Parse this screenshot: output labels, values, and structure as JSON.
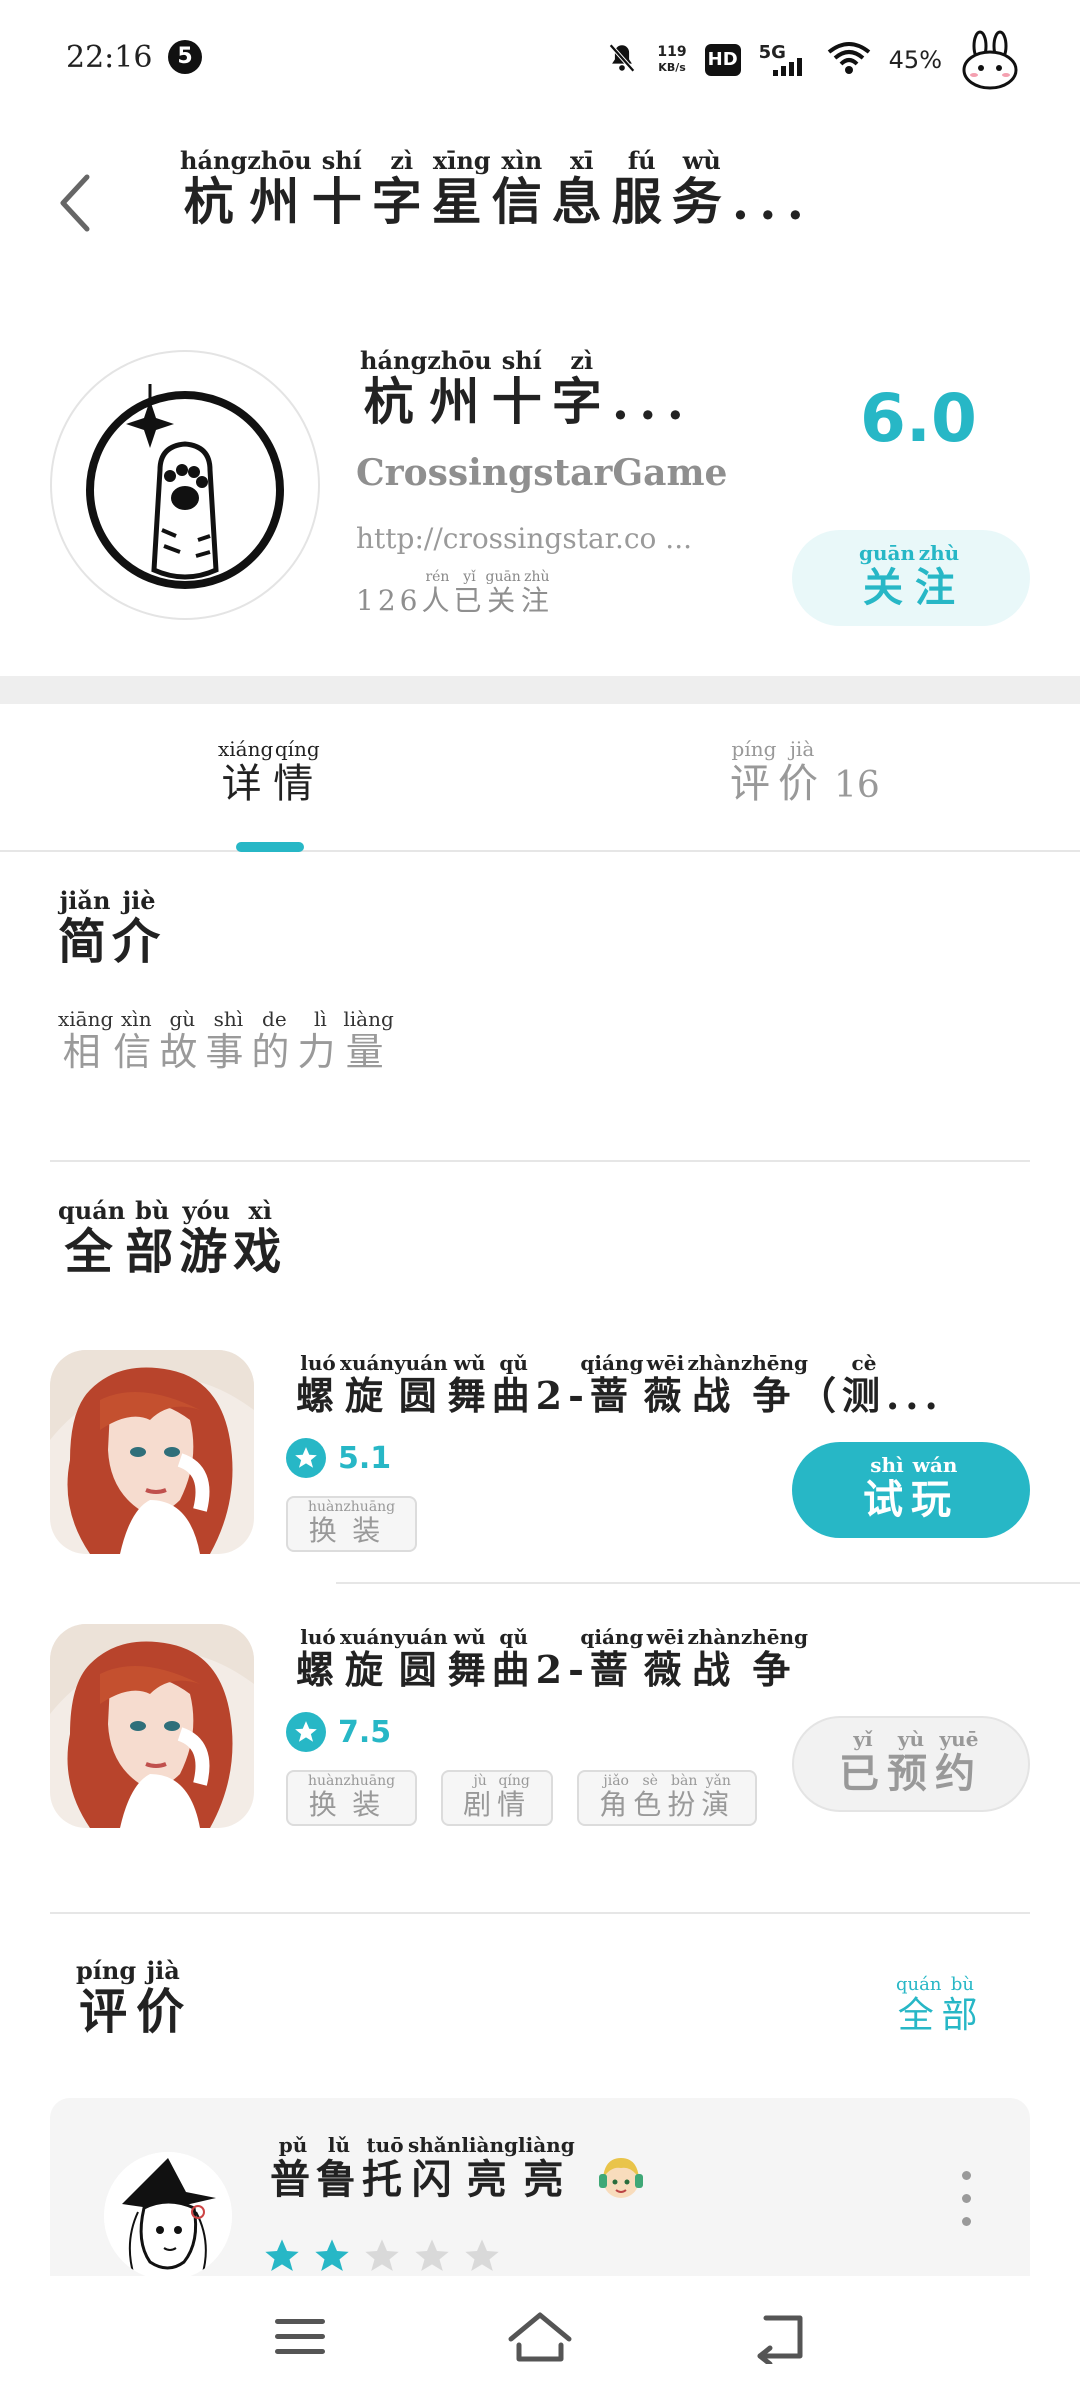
{
  "status_bar": {
    "time": "22:16",
    "notification_count": "5",
    "net_speed_value": "119",
    "net_speed_unit": "KB/s",
    "hd_label": "HD",
    "network_label": "5G",
    "battery": "45%"
  },
  "header": {
    "title": [
      {
        "c": "杭",
        "p": "háng"
      },
      {
        "c": "州",
        "p": "zhōu"
      },
      {
        "c": "十",
        "p": "shí"
      },
      {
        "c": "字",
        "p": "zì"
      },
      {
        "c": "星",
        "p": "xīng"
      },
      {
        "c": "信",
        "p": "xìn"
      },
      {
        "c": "息",
        "p": "xī"
      },
      {
        "c": "服",
        "p": "fú"
      },
      {
        "c": "务",
        "p": "wù"
      }
    ],
    "title_ellipsis": "..."
  },
  "developer": {
    "name": [
      {
        "c": "杭",
        "p": "háng"
      },
      {
        "c": "州",
        "p": "zhōu"
      },
      {
        "c": "十",
        "p": "shí"
      },
      {
        "c": "字",
        "p": "zì"
      }
    ],
    "name_ellipsis": "...",
    "english_name": "CrossingstarGame",
    "url": "http://crossingstar.co ...",
    "followers_count": "126",
    "followers_suffix": [
      {
        "c": "人",
        "p": "rén"
      },
      {
        "c": "已",
        "p": "yǐ"
      },
      {
        "c": "关",
        "p": "guān"
      },
      {
        "c": "注",
        "p": "zhù"
      }
    ],
    "score": "6.0",
    "follow_button": [
      {
        "c": "关",
        "p": "guān"
      },
      {
        "c": "注",
        "p": "zhù"
      }
    ]
  },
  "tabs": {
    "details": [
      {
        "c": "详",
        "p": "xiáng"
      },
      {
        "c": "情",
        "p": "qíng"
      }
    ],
    "reviews": [
      {
        "c": "评",
        "p": "píng"
      },
      {
        "c": "价",
        "p": "jià"
      }
    ],
    "reviews_count": "16"
  },
  "intro": {
    "title": [
      {
        "c": "简",
        "p": "jiǎn"
      },
      {
        "c": "介",
        "p": "jiè"
      }
    ],
    "text": [
      {
        "c": "相",
        "p": "xiāng"
      },
      {
        "c": "信",
        "p": "xìn"
      },
      {
        "c": "故",
        "p": "gù"
      },
      {
        "c": "事",
        "p": "shì"
      },
      {
        "c": "的",
        "p": "de"
      },
      {
        "c": "力",
        "p": "lì"
      },
      {
        "c": "量",
        "p": "liàng"
      }
    ]
  },
  "games_section": {
    "title": [
      {
        "c": "全",
        "p": "quán"
      },
      {
        "c": "部",
        "p": "bù"
      },
      {
        "c": "游",
        "p": "yóu"
      },
      {
        "c": "戏",
        "p": "xì"
      }
    ]
  },
  "games": [
    {
      "name": [
        {
          "c": "螺",
          "p": "luó"
        },
        {
          "c": "旋",
          "p": "xuán"
        },
        {
          "c": "圆",
          "p": "yuán"
        },
        {
          "c": "舞",
          "p": "wǔ"
        },
        {
          "c": "曲",
          "p": "qǔ"
        },
        {
          "c": "2-",
          "p": ""
        },
        {
          "c": "蔷",
          "p": "qiáng"
        },
        {
          "c": "薇",
          "p": "wēi"
        },
        {
          "c": "战",
          "p": "zhàn"
        },
        {
          "c": "争",
          "p": "zhēng"
        },
        {
          "c": "（",
          "p": ""
        },
        {
          "c": "测",
          "p": "cè"
        }
      ],
      "name_ellipsis": "...",
      "rating": "5.1",
      "tags": [
        [
          {
            "c": "换",
            "p": "huàn"
          },
          {
            "c": "装",
            "p": "zhuāng"
          }
        ]
      ],
      "action": [
        {
          "c": "试",
          "p": "shì"
        },
        {
          "c": "玩",
          "p": "wán"
        }
      ],
      "action_type": "play"
    },
    {
      "name": [
        {
          "c": "螺",
          "p": "luó"
        },
        {
          "c": "旋",
          "p": "xuán"
        },
        {
          "c": "圆",
          "p": "yuán"
        },
        {
          "c": "舞",
          "p": "wǔ"
        },
        {
          "c": "曲",
          "p": "qǔ"
        },
        {
          "c": "2-",
          "p": ""
        },
        {
          "c": "蔷",
          "p": "qiáng"
        },
        {
          "c": "薇",
          "p": "wēi"
        },
        {
          "c": "战",
          "p": "zhàn"
        },
        {
          "c": "争",
          "p": "zhēng"
        }
      ],
      "name_ellipsis": "",
      "rating": "7.5",
      "tags": [
        [
          {
            "c": "换",
            "p": "huàn"
          },
          {
            "c": "装",
            "p": "zhuāng"
          }
        ],
        [
          {
            "c": "剧",
            "p": "jù"
          },
          {
            "c": "情",
            "p": "qíng"
          }
        ],
        [
          {
            "c": "角",
            "p": "jiǎo"
          },
          {
            "c": "色",
            "p": "sè"
          },
          {
            "c": "扮",
            "p": "bàn"
          },
          {
            "c": "演",
            "p": "yǎn"
          }
        ]
      ],
      "action": [
        {
          "c": "已",
          "p": "yǐ"
        },
        {
          "c": "预",
          "p": "yù"
        },
        {
          "c": "约",
          "p": "yuē"
        }
      ],
      "action_type": "reserved"
    }
  ],
  "reviews_section": {
    "title": [
      {
        "c": "评",
        "p": "píng"
      },
      {
        "c": "价",
        "p": "jià"
      }
    ],
    "all_link": [
      {
        "c": "全",
        "p": "quán"
      },
      {
        "c": "部",
        "p": "bù"
      }
    ]
  },
  "review": {
    "user_name": [
      {
        "c": "普",
        "p": "pǔ"
      },
      {
        "c": "鲁",
        "p": "lǔ"
      },
      {
        "c": "托",
        "p": "tuō"
      },
      {
        "c": "闪",
        "p": "shǎn"
      },
      {
        "c": "亮",
        "p": "liàng"
      },
      {
        "c": "亮",
        "p": "liàng"
      }
    ],
    "stars": 2,
    "stars_max": 5
  },
  "colors": {
    "accent": "#27b7c6",
    "accent_light": "#e9f8f9",
    "muted_text": "#999999",
    "band": "#eeeeee",
    "card_bg": "#f5f5f5"
  },
  "icons": {
    "back": "chevron-left-icon",
    "rating": "star-icon",
    "more": "more-vertical-icon",
    "nav_menu": "menu-icon",
    "nav_home": "home-icon",
    "nav_back": "back-icon"
  }
}
